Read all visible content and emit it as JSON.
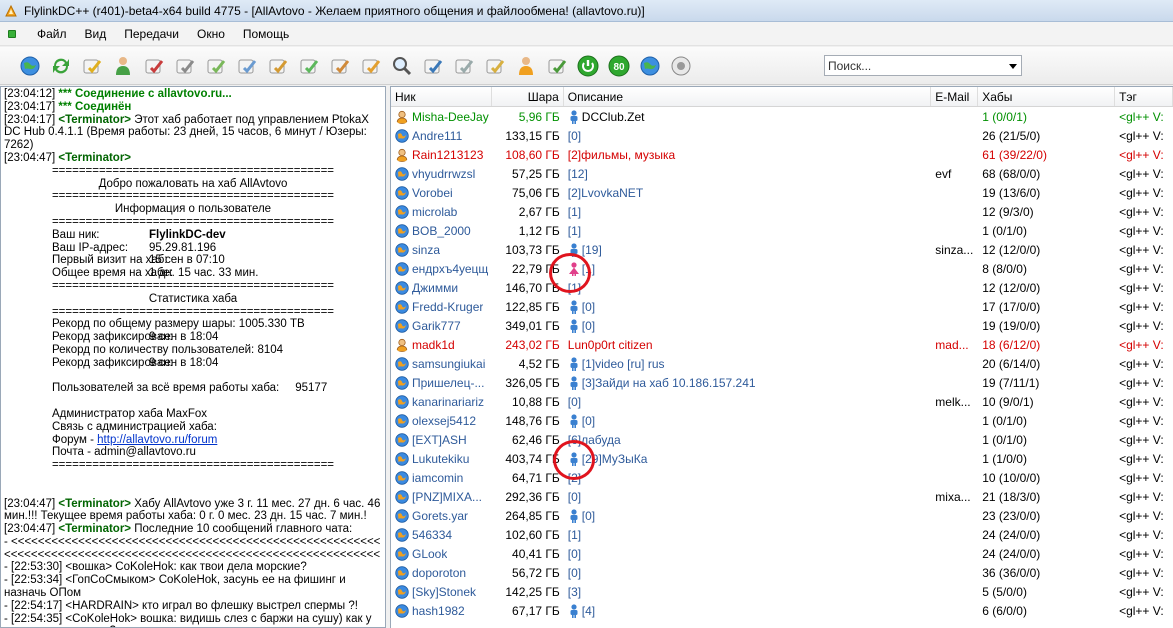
{
  "window": {
    "title": "FlylinkDC++ (r401)-beta4-x64 build 4775 - [AllAvtovo - Желаем приятного общения и файлообмена! (allavtovo.ru)]"
  },
  "menu": [
    "Файл",
    "Вид",
    "Передачи",
    "Окно",
    "Помощь"
  ],
  "toolbar": {
    "icons": [
      "connect-icon",
      "refresh-icon",
      "favorites-icon",
      "users-icon",
      "recent-hubs-icon",
      "queue-icon",
      "finished-icon",
      "upload-queue-icon",
      "finished-uploads-icon",
      "download-icon",
      "upload-icon",
      "network-stats-icon",
      "search-icon",
      "adl-search-icon",
      "file-list-icon",
      "notepad-icon",
      "away-icon",
      "settings-icon",
      "limiter-icon",
      "speed-80-icon",
      "globe-icon",
      "sound-icon"
    ],
    "speed_label": "80"
  },
  "search": {
    "placeholder": "Поиск..."
  },
  "chat": {
    "lines": [
      {
        "t": "[23:04:12] ",
        "b": "*** Соединение с allavtovo.ru...",
        "cls": "bold-green"
      },
      {
        "t": "[23:04:17] ",
        "b": "*** Соединён",
        "cls": "bold-green"
      }
    ],
    "hub_msg_time": "[23:04:17] ",
    "hub_msg_nick": "<Terminator>",
    "hub_msg_text": " Этот хаб работает под управлением PtokaX DC Hub 0.4.1.1 (Время работы: 23 дней, 15 часов, 6 минут / Юзеры: 7262)",
    "motd_time": "[23:04:47] ",
    "motd_nick": "<Terminator>",
    "sep": "==========================================",
    "welcome": "Добро пожаловать на хаб AllAvtovo",
    "user_info_title": "Информация о пользователе",
    "nick_label": "Ваш ник:",
    "nick_value": "FlylinkDC-dev",
    "ip_label": "Ваш IP-адрес:",
    "ip_value": "95.29.81.196",
    "first_visit_label": "Первый визит на хаб:",
    "first_visit_value": "15 сен в 07:10",
    "total_time_label": "Общее время на хабе:",
    "total_time_value": "1 дн. 15 час. 33 мин.",
    "stats_title": "Статистика хаба",
    "share_record_label": "Рекорд по общему размеру шары:",
    "share_record_value": "1005.330 TB",
    "share_record_fixed_label": "Рекорд зафиксирован:",
    "share_record_fixed_value": "9 сен в 18:04",
    "users_record_label": "Рекорд по количеству пользователей:",
    "users_record_value": "8104",
    "users_record_fixed_label": "Рекорд зафиксирован:",
    "users_record_fixed_value": "9 сен в 18:04",
    "users_total_label": "Пользователей за всё время работы хаба:",
    "users_total_value": "95177",
    "admin": "Администратор хаба MaxFox",
    "contact": "Связь с администрацией хаба:",
    "forum_label": "Форум - ",
    "forum_link": "http://allavtovo.ru/forum",
    "mail": "Почта - admin@allavtovo.ru",
    "uptime_time": "[23:04:47] ",
    "uptime_nick": "<Terminator>",
    "uptime_text": " Хабу AllAvtovo уже 3 г. 11 мес. 27 дн. 6 час. 46 мин.!!! Текущее время работы хаба: 0 г. 0 мес. 23 дн. 15 час. 7 мин.!",
    "last10_time": "[23:04:47] ",
    "last10_nick": "<Terminator>",
    "last10_text": " Последние 10 сообщений главного чата:",
    "arrows": "- <<<<<<<<<<<<<<<<<<<<<<<<<<<<<<<<<<<<<<<<<<<<<<<<<<<<<<<<<<<<<<<<<<<<<<<<<<<<<<<<<<<<<<<<<<<<<<<<<<<<<<<<<<<<<<<<<<<<<<<<<<",
    "history": [
      "- [22:53:30] <вошка> CoKoleHok: как твои дела морские?",
      "- [22:53:34] <ГопСоСмыком> CoKoleHok, засунь ее на фишинг и назначь ОПом",
      "- [22:54:17] <HARDRAIN> кто играл во флешку выстрел спермы ?!",
      "- [22:54:35] <CoKoleHok> вошка: видишь слез с баржи на сушу) как у тя сухопутные дела?"
    ]
  },
  "userlist": {
    "columns": {
      "nick": "Ник",
      "share": "Шара",
      "desc": "Описание",
      "email": "E-Mail",
      "hubs": "Хабы",
      "tag": "Тэг"
    },
    "rows": [
      {
        "nick": "Misha-DeeJay",
        "share": "5,96 ГБ",
        "desc": "DCClub.Zet",
        "email": "",
        "hubs": "1 (0/0/1)",
        "tag": "<gl++ V:",
        "cls": "op",
        "avatar": "op",
        "dicon": "pc"
      },
      {
        "nick": "Andre111",
        "share": "133,15 ГБ",
        "desc": "[0]",
        "email": "",
        "hubs": "26 (21/5/0)",
        "tag": "<gl++ V:",
        "cls": "",
        "avatar": "globe",
        "dicon": ""
      },
      {
        "nick": "Rain1213123",
        "share": "108,60 ГБ",
        "desc": "[2]фильмы, музыка",
        "email": "",
        "hubs": "61 (39/22/0)",
        "tag": "<gl++ V:",
        "cls": "red",
        "avatar": "op",
        "dicon": ""
      },
      {
        "nick": "vhyudrrwzsl",
        "share": "57,25 ГБ",
        "desc": "[12]",
        "email": "evf",
        "hubs": "68 (68/0/0)",
        "tag": "<gl++ V:",
        "cls": "",
        "avatar": "globe",
        "dicon": ""
      },
      {
        "nick": "Vorobei",
        "share": "75,06 ГБ",
        "desc": "[2]LvovkaNET",
        "email": "",
        "hubs": "19 (13/6/0)",
        "tag": "<gl++ V:",
        "cls": "",
        "avatar": "globe",
        "dicon": ""
      },
      {
        "nick": "microlab",
        "share": "2,67 ГБ",
        "desc": "[1]",
        "email": "",
        "hubs": "12 (9/3/0)",
        "tag": "<gl++ V:",
        "cls": "",
        "avatar": "globe",
        "dicon": ""
      },
      {
        "nick": "BOB_2000",
        "share": "1,12 ГБ",
        "desc": "[1]",
        "email": "",
        "hubs": "1 (0/1/0)",
        "tag": "<gl++ V:",
        "cls": "",
        "avatar": "globe",
        "dicon": ""
      },
      {
        "nick": "sinza",
        "share": "103,73 ГБ",
        "desc": "[19]",
        "email": "sinza...",
        "hubs": "12 (12/0/0)",
        "tag": "<gl++ V:",
        "cls": "",
        "avatar": "globe",
        "dicon": "male"
      },
      {
        "nick": "ендрхъ4уецщ",
        "share": "22,79 ГБ",
        "desc": "[1]",
        "email": "",
        "hubs": "8 (8/0/0)",
        "tag": "<gl++ V:",
        "cls": "",
        "avatar": "globe",
        "dicon": "female"
      },
      {
        "nick": "Джимми",
        "share": "146,70 ГБ",
        "desc": "[1]",
        "email": "",
        "hubs": "12 (12/0/0)",
        "tag": "<gl++ V:",
        "cls": "",
        "avatar": "globe",
        "dicon": ""
      },
      {
        "nick": "Fredd-Kruger",
        "share": "122,85 ГБ",
        "desc": "[0]",
        "email": "",
        "hubs": "17 (17/0/0)",
        "tag": "<gl++ V:",
        "cls": "",
        "avatar": "globe",
        "dicon": "male"
      },
      {
        "nick": "Garik777",
        "share": "349,01 ГБ",
        "desc": "[0]",
        "email": "",
        "hubs": "19 (19/0/0)",
        "tag": "<gl++ V:",
        "cls": "",
        "avatar": "globe",
        "dicon": "male"
      },
      {
        "nick": "madk1d",
        "share": "243,02 ГБ",
        "desc": "Lun0p0rt citizen",
        "email": "mad...",
        "hubs": "18 (6/12/0)",
        "tag": "<gl++ V:",
        "cls": "red",
        "avatar": "op",
        "dicon": ""
      },
      {
        "nick": "samsungiukai",
        "share": "4,52 ГБ",
        "desc": "[1]video [ru] rus",
        "email": "",
        "hubs": "20 (6/14/0)",
        "tag": "<gl++ V:",
        "cls": "",
        "avatar": "globe",
        "dicon": "male"
      },
      {
        "nick": "Пришелец-...",
        "share": "326,05 ГБ",
        "desc": "[3]Зайди на хаб 10.186.157.241",
        "email": "",
        "hubs": "19 (7/11/1)",
        "tag": "<gl++ V:",
        "cls": "",
        "avatar": "globe",
        "dicon": "male"
      },
      {
        "nick": "kanarinariariz",
        "share": "10,88 ГБ",
        "desc": "[0]",
        "email": "melk...",
        "hubs": "10 (9/0/1)",
        "tag": "<gl++ V:",
        "cls": "",
        "avatar": "globe",
        "dicon": ""
      },
      {
        "nick": "olexsej5412",
        "share": "148,76 ГБ",
        "desc": "[0]",
        "email": "",
        "hubs": "1 (0/1/0)",
        "tag": "<gl++ V:",
        "cls": "",
        "avatar": "globe",
        "dicon": "male"
      },
      {
        "nick": "[EXT]ASH",
        "share": "62,46 ГБ",
        "desc": "[6]лабуда",
        "email": "",
        "hubs": "1 (0/1/0)",
        "tag": "<gl++ V:",
        "cls": "",
        "avatar": "globe",
        "dicon": ""
      },
      {
        "nick": "Lukutekiku",
        "share": "403,74 ГБ",
        "desc": "[29]МуЗыКа",
        "email": "",
        "hubs": "1 (1/0/0)",
        "tag": "<gl++ V:",
        "cls": "",
        "avatar": "globe",
        "dicon": "male"
      },
      {
        "nick": "iamcomin",
        "share": "64,71 ГБ",
        "desc": "[2]",
        "email": "",
        "hubs": "10 (10/0/0)",
        "tag": "<gl++ V:",
        "cls": "",
        "avatar": "globe",
        "dicon": ""
      },
      {
        "nick": "[PNZ]MIXA...",
        "share": "292,36 ГБ",
        "desc": "[0]",
        "email": "mixa...",
        "hubs": "21 (18/3/0)",
        "tag": "<gl++ V:",
        "cls": "",
        "avatar": "globe",
        "dicon": ""
      },
      {
        "nick": "Gorets.yar",
        "share": "264,85 ГБ",
        "desc": "[0]",
        "email": "",
        "hubs": "23 (23/0/0)",
        "tag": "<gl++ V:",
        "cls": "",
        "avatar": "globe",
        "dicon": "male"
      },
      {
        "nick": "546334",
        "share": "102,60 ГБ",
        "desc": "[1]",
        "email": "",
        "hubs": "24 (24/0/0)",
        "tag": "<gl++ V:",
        "cls": "",
        "avatar": "globe",
        "dicon": ""
      },
      {
        "nick": "GLook",
        "share": "40,41 ГБ",
        "desc": "[0]",
        "email": "",
        "hubs": "24 (24/0/0)",
        "tag": "<gl++ V:",
        "cls": "",
        "avatar": "globe",
        "dicon": ""
      },
      {
        "nick": "doporoton",
        "share": "56,72 ГБ",
        "desc": "[0]",
        "email": "",
        "hubs": "36 (36/0/0)",
        "tag": "<gl++ V:",
        "cls": "",
        "avatar": "globe",
        "dicon": ""
      },
      {
        "nick": "[Sky]Stonek",
        "share": "142,25 ГБ",
        "desc": "[3]",
        "email": "",
        "hubs": "5 (5/0/0)",
        "tag": "<gl++ V:",
        "cls": "",
        "avatar": "globe",
        "dicon": ""
      },
      {
        "nick": "hash1982",
        "share": "67,17 ГБ",
        "desc": "[4]",
        "email": "",
        "hubs": "6 (6/0/0)",
        "tag": "<gl++ V:",
        "cls": "",
        "avatar": "globe",
        "dicon": "male"
      }
    ]
  },
  "colors": {
    "accent_red_circle": "#e0141e",
    "op_green": "#009000",
    "passive_red": "#d40000"
  }
}
